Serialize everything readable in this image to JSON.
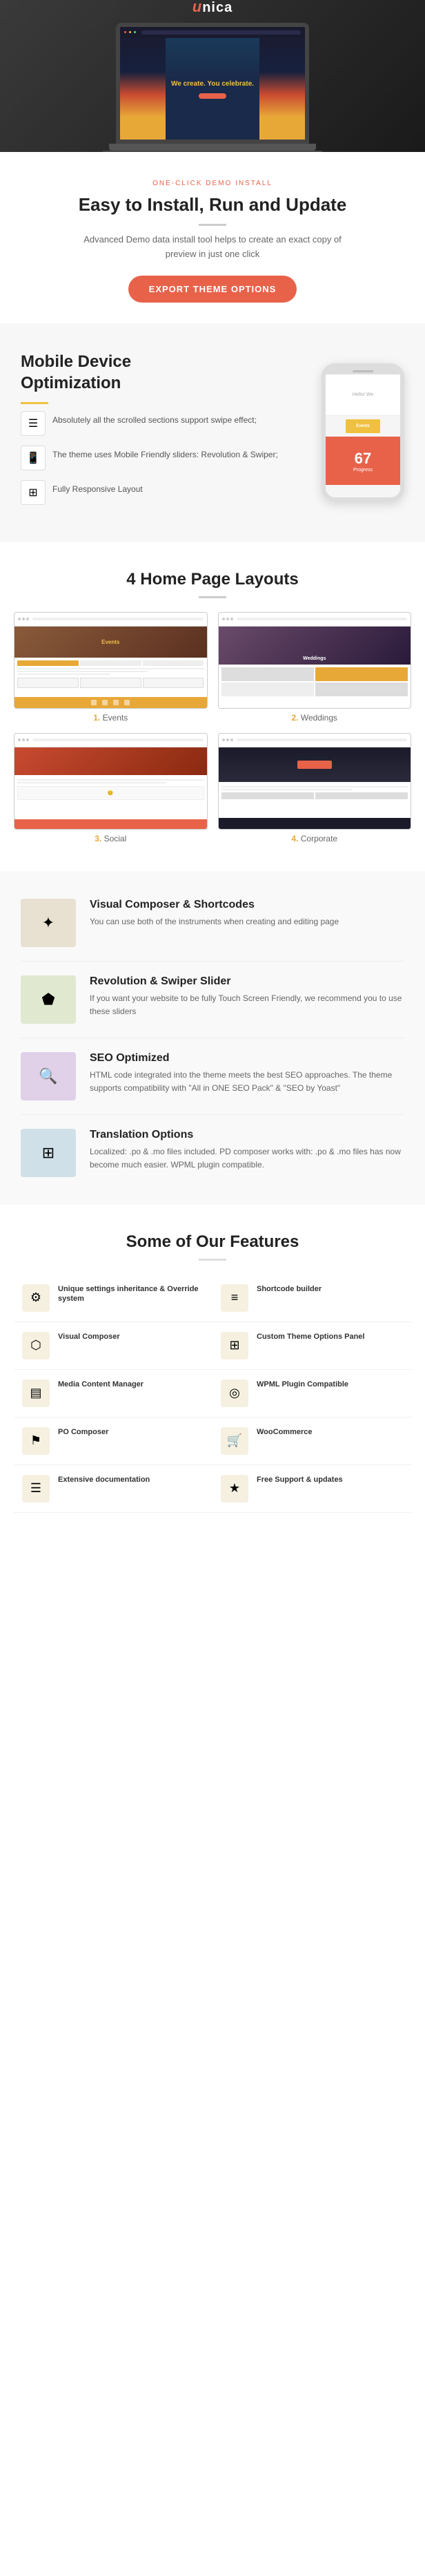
{
  "hero": {
    "laptop_screen_text": "We create.\nYou\ncelebrate."
  },
  "install": {
    "tag": "ONE-CLICK DEMO INSTALL",
    "title": "Easy to Install, Run and Update",
    "description": "Advanced Demo data install tool helps to create an exact copy of preview in just one click",
    "button_label": "EXPORT THEME OPTIONS"
  },
  "mobile": {
    "title": "Mobile Device\nOptimization",
    "features": [
      {
        "text": "Absolutely all the scrolled sections support swipe effect;"
      },
      {
        "text": "The theme uses Mobile Friendly sliders: Revolution & Swiper;"
      },
      {
        "text": "Fully Responsive Layout"
      }
    ],
    "phone_number": "67",
    "phone_label": "Progress"
  },
  "layouts": {
    "title": "4 Home Page Layouts",
    "items": [
      {
        "number": "1.",
        "label": "Events"
      },
      {
        "number": "2.",
        "label": "Weddings"
      },
      {
        "number": "3.",
        "label": "Social"
      },
      {
        "number": "4.",
        "label": "Corporate"
      }
    ]
  },
  "feature_rows": [
    {
      "icon": "✦",
      "title": "Visual Composer & Shortcodes",
      "description": "You can use both of the instruments when creating and editing page"
    },
    {
      "icon": "◈",
      "title": "Revolution & Swiper Slider",
      "description": "If you want your website to be fully Touch Screen Friendly, we recommend you to use these sliders"
    },
    {
      "icon": "⊕",
      "title": "SEO Optimized",
      "description": "HTML code integrated into the theme meets the best SEO approaches. The theme supports compatibility with \"All in ONE SEO Pack\" & \"SEO by Yoast\""
    },
    {
      "icon": "⊞",
      "title": "Translation Options",
      "description": "Localized: .po & .mo files included. PD composer works with: .po & .mo files has now become much easier. WPML plugin compatible."
    }
  ],
  "our_features": {
    "title": "Some of Our Features",
    "items": [
      {
        "icon": "⚙",
        "name": "Unique settings inheritance & Override system"
      },
      {
        "icon": "≡",
        "name": "Shortcode builder"
      },
      {
        "icon": "⬡",
        "name": "Visual Composer"
      },
      {
        "icon": "⊞",
        "name": "Custom Theme Options Panel"
      },
      {
        "icon": "▤",
        "name": "Media Content Manager"
      },
      {
        "icon": "◎",
        "name": "WPML Plugin Compatible"
      },
      {
        "icon": "⚑",
        "name": "PO Composer"
      },
      {
        "icon": "🛒",
        "name": "WooCommerce"
      },
      {
        "icon": "☰",
        "name": "Extensive documentation"
      },
      {
        "icon": "★",
        "name": "Free Support & updates"
      }
    ]
  }
}
